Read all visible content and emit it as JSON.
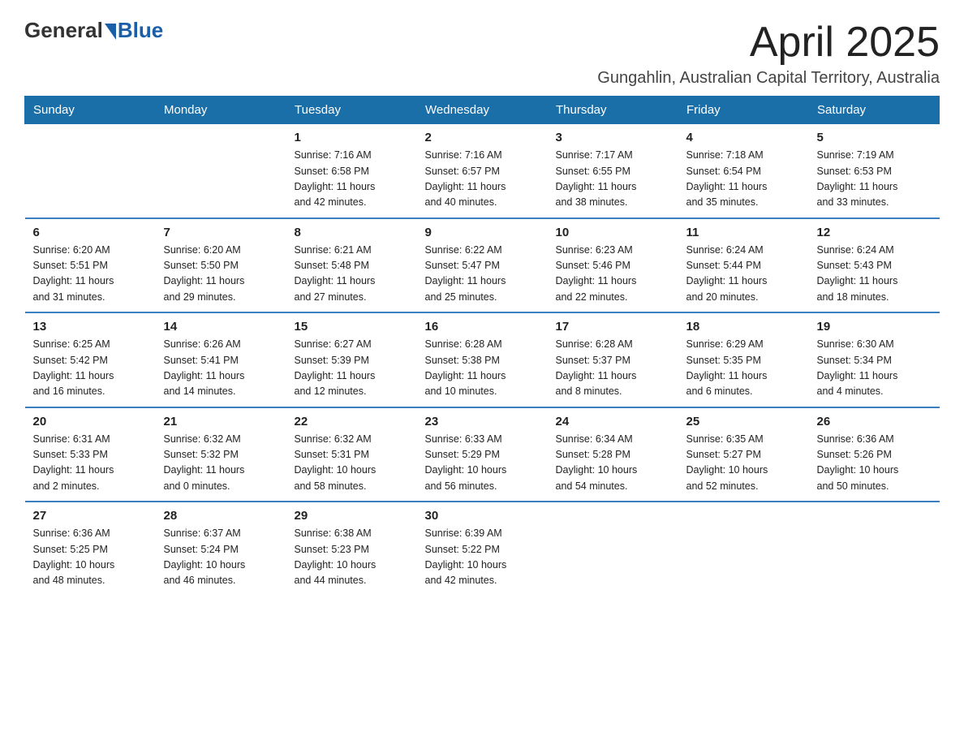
{
  "logo": {
    "general": "General",
    "blue": "Blue"
  },
  "title": "April 2025",
  "subtitle": "Gungahlin, Australian Capital Territory, Australia",
  "header_color": "#1a6fa8",
  "days_of_week": [
    "Sunday",
    "Monday",
    "Tuesday",
    "Wednesday",
    "Thursday",
    "Friday",
    "Saturday"
  ],
  "weeks": [
    [
      {
        "number": "",
        "info": ""
      },
      {
        "number": "",
        "info": ""
      },
      {
        "number": "1",
        "info": "Sunrise: 7:16 AM\nSunset: 6:58 PM\nDaylight: 11 hours\nand 42 minutes."
      },
      {
        "number": "2",
        "info": "Sunrise: 7:16 AM\nSunset: 6:57 PM\nDaylight: 11 hours\nand 40 minutes."
      },
      {
        "number": "3",
        "info": "Sunrise: 7:17 AM\nSunset: 6:55 PM\nDaylight: 11 hours\nand 38 minutes."
      },
      {
        "number": "4",
        "info": "Sunrise: 7:18 AM\nSunset: 6:54 PM\nDaylight: 11 hours\nand 35 minutes."
      },
      {
        "number": "5",
        "info": "Sunrise: 7:19 AM\nSunset: 6:53 PM\nDaylight: 11 hours\nand 33 minutes."
      }
    ],
    [
      {
        "number": "6",
        "info": "Sunrise: 6:20 AM\nSunset: 5:51 PM\nDaylight: 11 hours\nand 31 minutes."
      },
      {
        "number": "7",
        "info": "Sunrise: 6:20 AM\nSunset: 5:50 PM\nDaylight: 11 hours\nand 29 minutes."
      },
      {
        "number": "8",
        "info": "Sunrise: 6:21 AM\nSunset: 5:48 PM\nDaylight: 11 hours\nand 27 minutes."
      },
      {
        "number": "9",
        "info": "Sunrise: 6:22 AM\nSunset: 5:47 PM\nDaylight: 11 hours\nand 25 minutes."
      },
      {
        "number": "10",
        "info": "Sunrise: 6:23 AM\nSunset: 5:46 PM\nDaylight: 11 hours\nand 22 minutes."
      },
      {
        "number": "11",
        "info": "Sunrise: 6:24 AM\nSunset: 5:44 PM\nDaylight: 11 hours\nand 20 minutes."
      },
      {
        "number": "12",
        "info": "Sunrise: 6:24 AM\nSunset: 5:43 PM\nDaylight: 11 hours\nand 18 minutes."
      }
    ],
    [
      {
        "number": "13",
        "info": "Sunrise: 6:25 AM\nSunset: 5:42 PM\nDaylight: 11 hours\nand 16 minutes."
      },
      {
        "number": "14",
        "info": "Sunrise: 6:26 AM\nSunset: 5:41 PM\nDaylight: 11 hours\nand 14 minutes."
      },
      {
        "number": "15",
        "info": "Sunrise: 6:27 AM\nSunset: 5:39 PM\nDaylight: 11 hours\nand 12 minutes."
      },
      {
        "number": "16",
        "info": "Sunrise: 6:28 AM\nSunset: 5:38 PM\nDaylight: 11 hours\nand 10 minutes."
      },
      {
        "number": "17",
        "info": "Sunrise: 6:28 AM\nSunset: 5:37 PM\nDaylight: 11 hours\nand 8 minutes."
      },
      {
        "number": "18",
        "info": "Sunrise: 6:29 AM\nSunset: 5:35 PM\nDaylight: 11 hours\nand 6 minutes."
      },
      {
        "number": "19",
        "info": "Sunrise: 6:30 AM\nSunset: 5:34 PM\nDaylight: 11 hours\nand 4 minutes."
      }
    ],
    [
      {
        "number": "20",
        "info": "Sunrise: 6:31 AM\nSunset: 5:33 PM\nDaylight: 11 hours\nand 2 minutes."
      },
      {
        "number": "21",
        "info": "Sunrise: 6:32 AM\nSunset: 5:32 PM\nDaylight: 11 hours\nand 0 minutes."
      },
      {
        "number": "22",
        "info": "Sunrise: 6:32 AM\nSunset: 5:31 PM\nDaylight: 10 hours\nand 58 minutes."
      },
      {
        "number": "23",
        "info": "Sunrise: 6:33 AM\nSunset: 5:29 PM\nDaylight: 10 hours\nand 56 minutes."
      },
      {
        "number": "24",
        "info": "Sunrise: 6:34 AM\nSunset: 5:28 PM\nDaylight: 10 hours\nand 54 minutes."
      },
      {
        "number": "25",
        "info": "Sunrise: 6:35 AM\nSunset: 5:27 PM\nDaylight: 10 hours\nand 52 minutes."
      },
      {
        "number": "26",
        "info": "Sunrise: 6:36 AM\nSunset: 5:26 PM\nDaylight: 10 hours\nand 50 minutes."
      }
    ],
    [
      {
        "number": "27",
        "info": "Sunrise: 6:36 AM\nSunset: 5:25 PM\nDaylight: 10 hours\nand 48 minutes."
      },
      {
        "number": "28",
        "info": "Sunrise: 6:37 AM\nSunset: 5:24 PM\nDaylight: 10 hours\nand 46 minutes."
      },
      {
        "number": "29",
        "info": "Sunrise: 6:38 AM\nSunset: 5:23 PM\nDaylight: 10 hours\nand 44 minutes."
      },
      {
        "number": "30",
        "info": "Sunrise: 6:39 AM\nSunset: 5:22 PM\nDaylight: 10 hours\nand 42 minutes."
      },
      {
        "number": "",
        "info": ""
      },
      {
        "number": "",
        "info": ""
      },
      {
        "number": "",
        "info": ""
      }
    ]
  ]
}
